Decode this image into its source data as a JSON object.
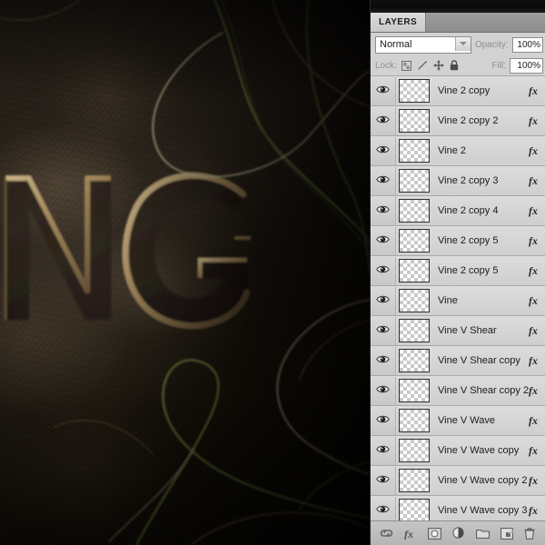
{
  "canvas": {
    "description": "Dark carved stone surface with engraved letters and vine strands",
    "letters": "NG",
    "vine_colors": [
      "#6d7a3a",
      "#b9ac8e",
      "#8d7a55"
    ],
    "stone_color": "#2b231a"
  },
  "panel": {
    "tab_label": "LAYERS",
    "blend_mode": "Normal",
    "blend_modes": [
      "Normal"
    ],
    "opacity_label": "Opacity:",
    "opacity_value": "100%",
    "fill_label": "Fill:",
    "fill_value": "100%",
    "lock_label": "Lock:",
    "lock_icons": [
      "lock-transparency-icon",
      "lock-image-pixels-icon",
      "lock-position-icon",
      "lock-all-icon"
    ],
    "layers": [
      {
        "name": "Vine 2 copy",
        "visible": true,
        "has_effects": true
      },
      {
        "name": "Vine 2 copy 2",
        "visible": true,
        "has_effects": true
      },
      {
        "name": "Vine 2",
        "visible": true,
        "has_effects": true
      },
      {
        "name": "Vine 2 copy 3",
        "visible": true,
        "has_effects": true
      },
      {
        "name": "Vine 2 copy 4",
        "visible": true,
        "has_effects": true
      },
      {
        "name": "Vine 2 copy 5",
        "visible": true,
        "has_effects": true
      },
      {
        "name": "Vine 2 copy 5",
        "visible": true,
        "has_effects": true
      },
      {
        "name": "Vine",
        "visible": true,
        "has_effects": true
      },
      {
        "name": "Vine V Shear",
        "visible": true,
        "has_effects": true
      },
      {
        "name": "Vine V Shear copy",
        "visible": true,
        "has_effects": true
      },
      {
        "name": "Vine V Shear copy 2",
        "visible": true,
        "has_effects": true
      },
      {
        "name": "Vine V Wave",
        "visible": true,
        "has_effects": true
      },
      {
        "name": "Vine V Wave copy",
        "visible": true,
        "has_effects": true
      },
      {
        "name": "Vine V Wave copy 2",
        "visible": true,
        "has_effects": true
      },
      {
        "name": "Vine V Wave copy 3",
        "visible": true,
        "has_effects": true
      }
    ],
    "fx_badge": "fx",
    "bottom_buttons": [
      "link-layers-icon",
      "layer-style-fx-icon",
      "add-layer-mask-icon",
      "new-adjustment-layer-icon",
      "new-group-icon",
      "new-layer-icon",
      "delete-layer-icon"
    ]
  }
}
